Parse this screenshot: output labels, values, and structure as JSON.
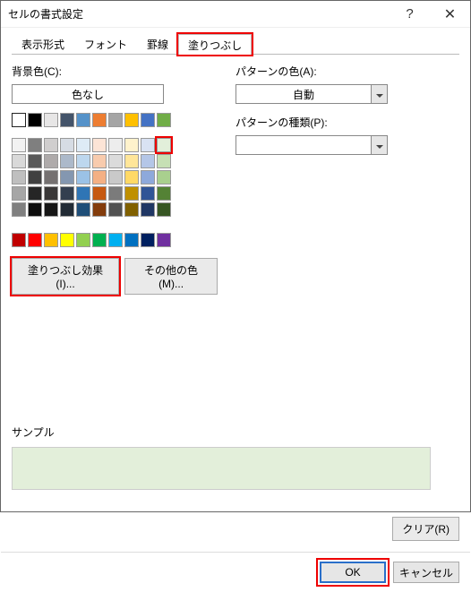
{
  "window": {
    "title": "セルの書式設定"
  },
  "tabs": {
    "format": "表示形式",
    "font": "フォント",
    "border": "罫線",
    "fill": "塗りつぶし"
  },
  "fill": {
    "bg_label": "背景色(C):",
    "no_color": "色なし",
    "effects_btn": "塗りつぶし効果(I)...",
    "other_colors_btn": "その他の色(M)...",
    "pattern_color_label": "パターンの色(A):",
    "pattern_color_value": "自動",
    "pattern_type_label": "パターンの種類(P):",
    "sample_label": "サンプル",
    "sample_color": "#e3efda"
  },
  "palette": {
    "top_row": [
      "#ffffff",
      "#000000",
      "#e7e6e6",
      "#44546a",
      "#5592c9",
      "#ed7d31",
      "#a5a5a5",
      "#ffc000",
      "#4472c4",
      "#70ad47"
    ],
    "theme_rows": [
      [
        "#f2f2f2",
        "#7f7f7f",
        "#d0cece",
        "#d6dce4",
        "#deebf6",
        "#fce4d6",
        "#ededed",
        "#fff2cc",
        "#d9e2f3",
        "#e2efda"
      ],
      [
        "#d9d9d9",
        "#595959",
        "#aeaaaa",
        "#acb9ca",
        "#bdd7ee",
        "#f8cbad",
        "#dbdbdb",
        "#ffe699",
        "#b4c6e7",
        "#c6e0b4"
      ],
      [
        "#bfbfbf",
        "#404040",
        "#757171",
        "#8497b0",
        "#9bc2e6",
        "#f4b084",
        "#c9c9c9",
        "#ffd966",
        "#8ea9db",
        "#a9d08e"
      ],
      [
        "#a6a6a6",
        "#262626",
        "#3a3838",
        "#333f4f",
        "#2f75b5",
        "#c65911",
        "#7b7b7b",
        "#bf8f00",
        "#305496",
        "#548235"
      ],
      [
        "#808080",
        "#0d0d0d",
        "#161616",
        "#222b35",
        "#1f4e78",
        "#833c0c",
        "#525252",
        "#806000",
        "#203764",
        "#375623"
      ]
    ],
    "standard_row": [
      "#c00000",
      "#ff0000",
      "#ffc000",
      "#ffff00",
      "#92d050",
      "#00b050",
      "#00b0f0",
      "#0070c0",
      "#002060",
      "#7030a0"
    ],
    "selected_row": 0,
    "selected_col": 9
  },
  "buttons": {
    "clear": "クリア(R)",
    "ok": "OK",
    "cancel": "キャンセル"
  }
}
